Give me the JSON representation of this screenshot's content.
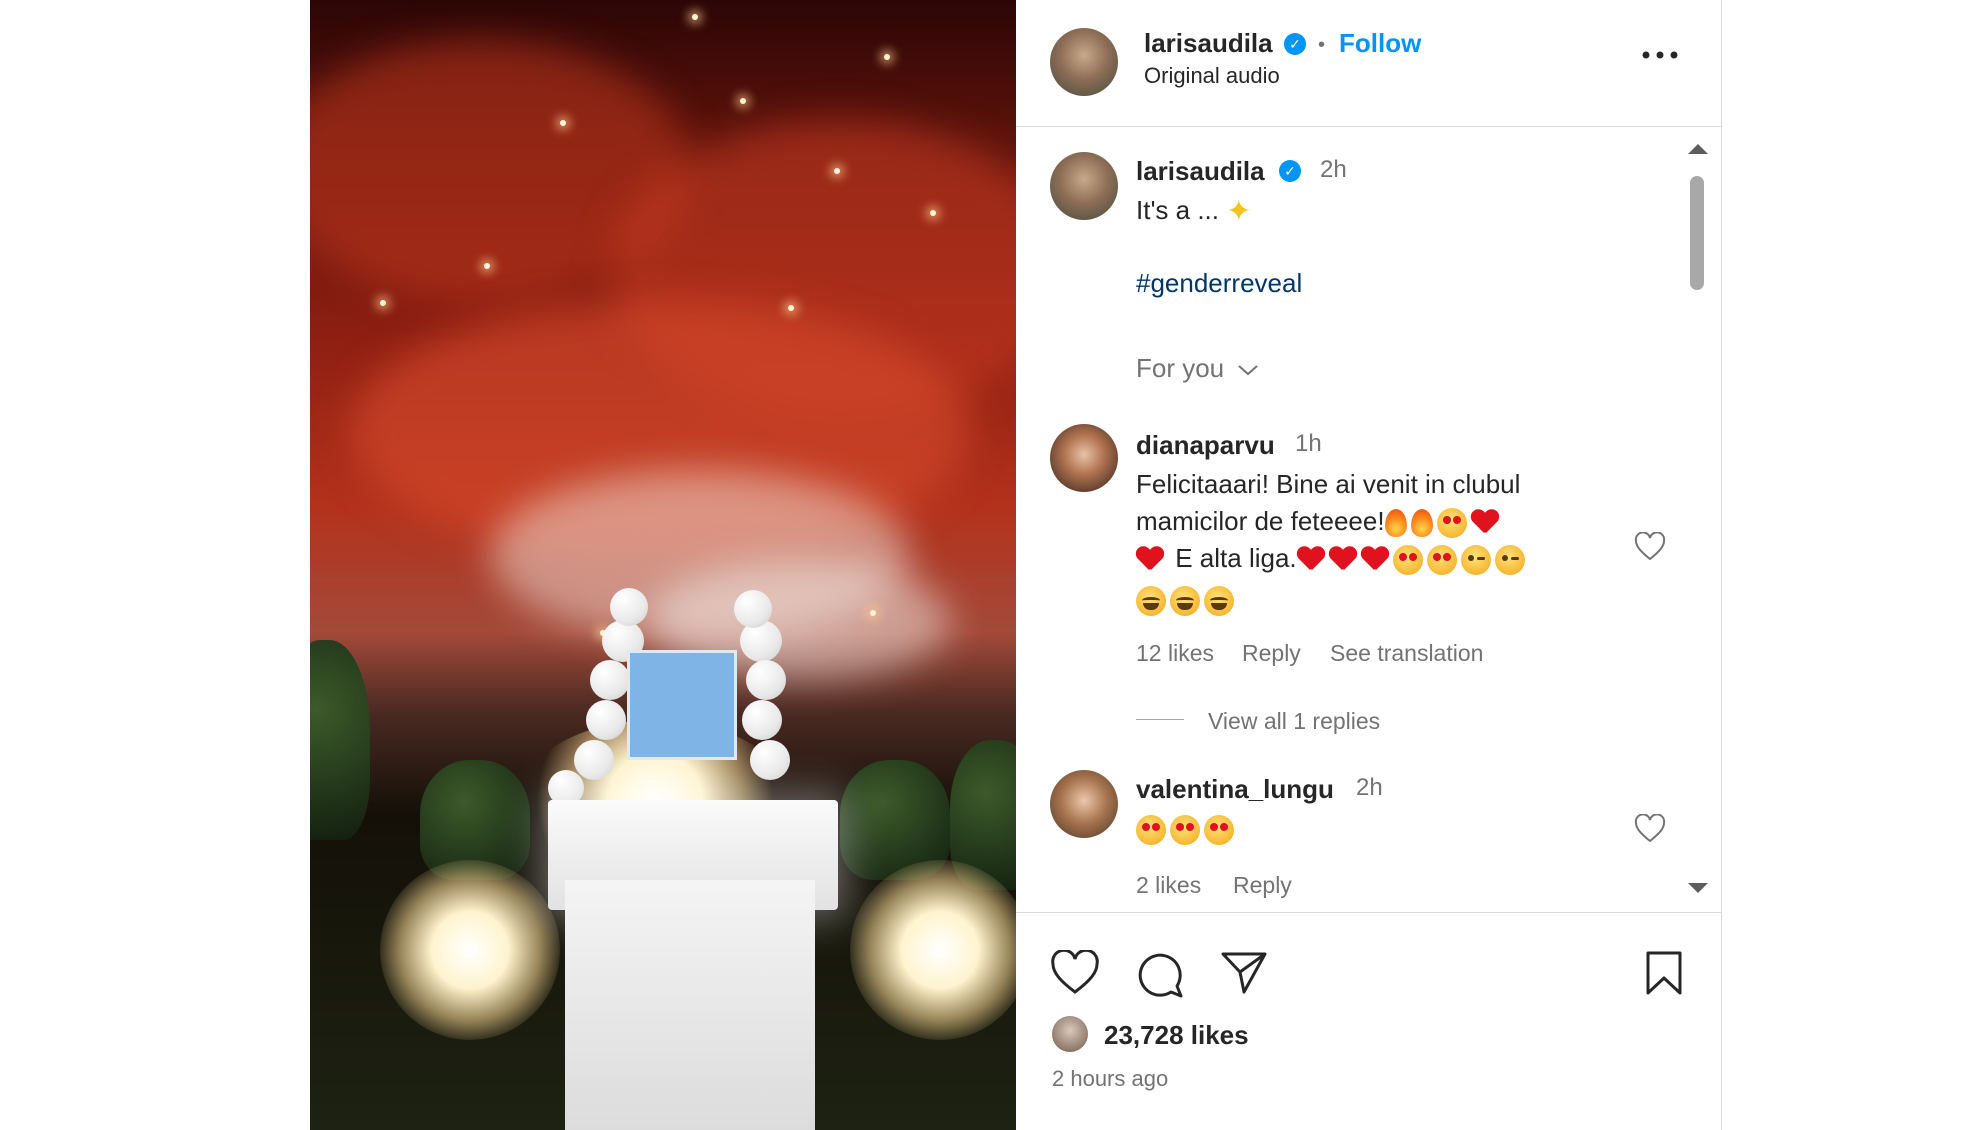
{
  "header": {
    "username": "larisaudila",
    "verified": true,
    "separator": "•",
    "follow_label": "Follow",
    "audio_label": "Original audio",
    "more_icon": "more-horizontal-icon"
  },
  "caption": {
    "username": "larisaudila",
    "verified": true,
    "timestamp": "2h",
    "text": "It's a ...",
    "emoji": "sparkles",
    "hashtag": "#genderreveal"
  },
  "sort": {
    "label": "For you",
    "icon": "chevron-down-icon"
  },
  "comments": [
    {
      "username": "dianaparvu",
      "timestamp": "1h",
      "line1": "Felicitaaari! Bine ai venit in clubul",
      "line2": "mamicilor de feteeee!",
      "line3": "E alta liga.",
      "likes": "12 likes",
      "reply_label": "Reply",
      "translation_label": "See translation",
      "view_replies": "View all 1 replies"
    },
    {
      "username": "valentina_lungu",
      "timestamp": "2h",
      "likes": "2 likes",
      "reply_label": "Reply"
    }
  ],
  "footer": {
    "likes_count": "23,728 likes",
    "time_ago": "2 hours ago",
    "icons": [
      "heart-icon",
      "comment-icon",
      "share-icon",
      "bookmark-icon"
    ]
  },
  "colors": {
    "accent": "#0095f6",
    "hashtag": "#00376b",
    "muted": "#737373",
    "border": "#dbdbdb",
    "heart_emoji": "#e0121e"
  }
}
